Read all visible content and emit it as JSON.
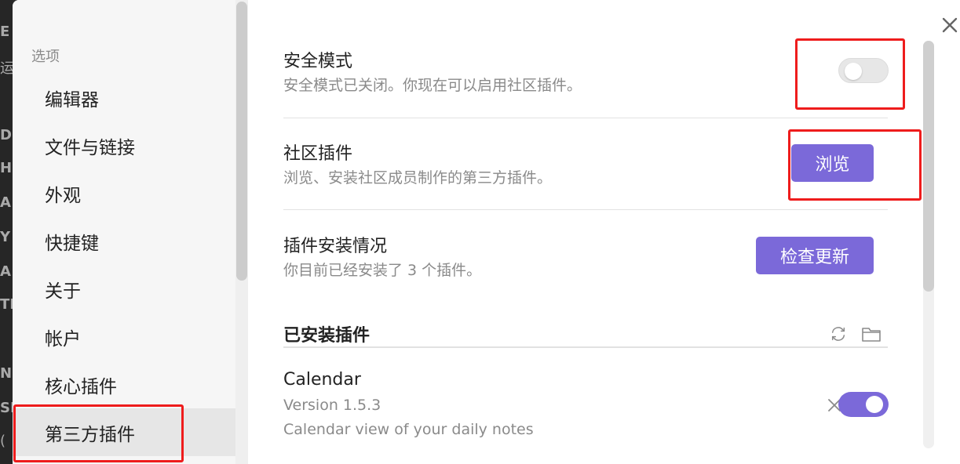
{
  "background_fragments": [
    "E",
    "运",
    "D",
    "H",
    "A",
    "Y",
    "A",
    "TH",
    "ND",
    "SIN",
    "("
  ],
  "sidebar": {
    "heading": "选项",
    "items": [
      {
        "label": "编辑器",
        "active": false
      },
      {
        "label": "文件与链接",
        "active": false
      },
      {
        "label": "外观",
        "active": false
      },
      {
        "label": "快捷键",
        "active": false
      },
      {
        "label": "关于",
        "active": false
      },
      {
        "label": "帐户",
        "active": false
      },
      {
        "label": "核心插件",
        "active": false
      },
      {
        "label": "第三方插件",
        "active": true
      }
    ]
  },
  "settings": {
    "safe_mode": {
      "title": "安全模式",
      "description": "安全模式已关闭。你现在可以启用社区插件。",
      "enabled": false
    },
    "community_plugins": {
      "title": "社区插件",
      "description": "浏览、安装社区成员制作的第三方插件。",
      "button_label": "浏览"
    },
    "plugin_status": {
      "title": "插件安装情况",
      "description": "你目前已经安装了 3 个插件。",
      "button_label": "检查更新"
    }
  },
  "installed": {
    "heading": "已安装插件",
    "icons": [
      "reload-icon",
      "folder-icon"
    ],
    "plugins": [
      {
        "name": "Calendar",
        "version": "Version 1.5.3",
        "description": "Calendar view of your daily notes",
        "enabled": true
      }
    ]
  },
  "colors": {
    "accent": "#7b69d9",
    "annotation": "#ee1c1c"
  }
}
